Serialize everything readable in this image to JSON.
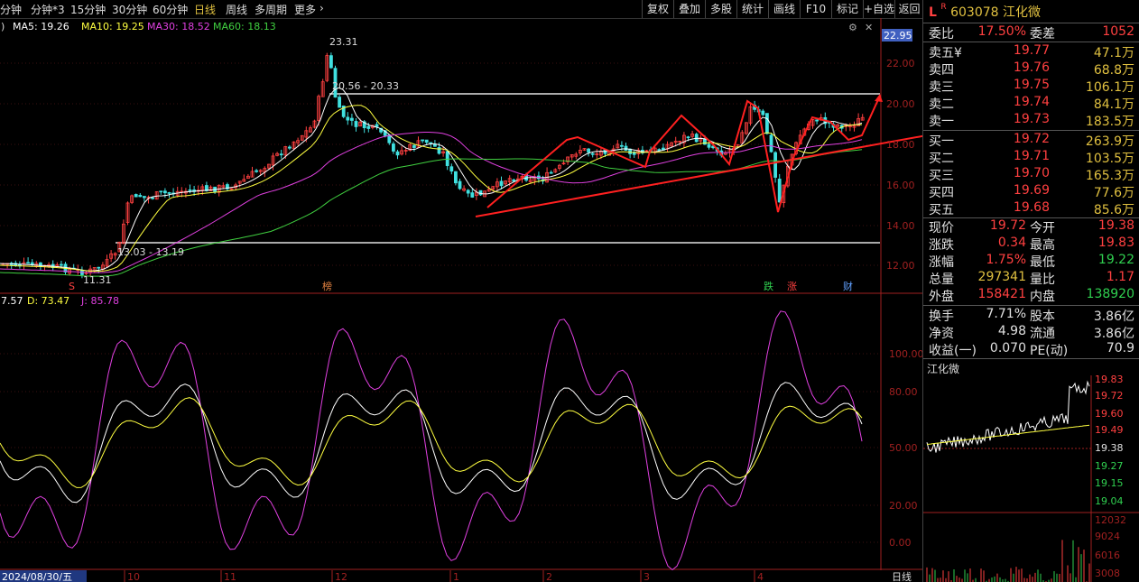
{
  "toolbar": {
    "periods": [
      "分钟",
      "分钟*3",
      "15分钟",
      "30分钟",
      "60分钟",
      "日线",
      "周线",
      "多周期",
      "更多"
    ],
    "active_period": "日线",
    "buttons": [
      "复权",
      "叠加",
      "多股",
      "统计",
      "画线",
      "F10",
      "标记",
      "+自选",
      "返回"
    ]
  },
  "stock": {
    "flag_l": "L",
    "flag_r": "R",
    "code": "603078",
    "name": "江化微"
  },
  "ma_legend": {
    "lead": ")",
    "ma5": "MA5: 19.26",
    "ma10": "MA10: 19.25",
    "ma30": "MA30: 18.52",
    "ma60": "MA60: 18.13"
  },
  "kdj_legend": {
    "k": "7.57",
    "d": "D: 73.47",
    "j": "J: 85.78"
  },
  "main_axis": {
    "labels": [
      "22.00",
      "20.00",
      "18.00",
      "16.00",
      "14.00",
      "12.00"
    ],
    "current": "22.95"
  },
  "kdj_axis": {
    "labels": [
      "100.00",
      "80.00",
      "50.00",
      "20.00",
      "0.00"
    ]
  },
  "annotations": {
    "high": "23.31",
    "resistance": "20.56 - 20.33",
    "support": "13.03 - 13.19",
    "low": "11.31",
    "marker_s": "S",
    "marker_bang": "榜",
    "marker_die": "跌",
    "marker_zhang": "涨",
    "marker_cai": "财"
  },
  "date_axis": {
    "first": "2024/08/30/五",
    "months": [
      "10",
      "11",
      "12",
      "1",
      "2",
      "3",
      "4"
    ],
    "period_label": "日线"
  },
  "orderbook": {
    "weibi_label": "委比",
    "weibi_value": "17.50%",
    "weicha_label": "委差",
    "weicha_value": "1052",
    "sells": [
      {
        "label": "卖五¥",
        "price": "19.77",
        "vol": "47.1万"
      },
      {
        "label": "卖四",
        "price": "19.76",
        "vol": "68.8万"
      },
      {
        "label": "卖三",
        "price": "19.75",
        "vol": "106.1万"
      },
      {
        "label": "卖二",
        "price": "19.74",
        "vol": "84.1万"
      },
      {
        "label": "卖一",
        "price": "19.73",
        "vol": "183.5万"
      }
    ],
    "buys": [
      {
        "label": "买一",
        "price": "19.72",
        "vol": "263.9万"
      },
      {
        "label": "买二",
        "price": "19.71",
        "vol": "103.5万"
      },
      {
        "label": "买三",
        "price": "19.70",
        "vol": "165.3万"
      },
      {
        "label": "买四",
        "price": "19.69",
        "vol": "77.6万"
      },
      {
        "label": "买五",
        "price": "19.68",
        "vol": "85.6万"
      }
    ]
  },
  "quote": [
    {
      "l1": "现价",
      "v1": "19.72",
      "c1": "red",
      "l2": "今开",
      "v2": "19.38",
      "c2": "red"
    },
    {
      "l1": "涨跌",
      "v1": "0.34",
      "c1": "red",
      "l2": "最高",
      "v2": "19.83",
      "c2": "red"
    },
    {
      "l1": "涨幅",
      "v1": "1.75%",
      "c1": "red",
      "l2": "最低",
      "v2": "19.22",
      "c2": "grn"
    },
    {
      "l1": "总量",
      "v1": "297341",
      "c1": "yel",
      "l2": "量比",
      "v2": "1.17",
      "c2": "red"
    },
    {
      "l1": "外盘",
      "v1": "158421",
      "c1": "red",
      "l2": "内盘",
      "v2": "138920",
      "c2": "grn"
    }
  ],
  "fundamentals": [
    {
      "l1": "换手",
      "v1": "7.71%",
      "l2": "股本",
      "v2": "3.86亿"
    },
    {
      "l1": "净资",
      "v1": "4.98",
      "l2": "流通",
      "v2": "3.86亿"
    },
    {
      "l1": "收益(一)",
      "v1": "0.070",
      "l2": "PE(动)",
      "v2": "70.9"
    }
  ],
  "intraday": {
    "title": "江化微",
    "price_labels": [
      "19.83",
      "19.72",
      "19.60",
      "19.49",
      "19.38",
      "19.27",
      "19.15",
      "19.04"
    ],
    "price_colors": [
      "red",
      "red",
      "red",
      "red",
      "wht",
      "grn",
      "grn",
      "grn"
    ],
    "vol_labels": [
      "12032",
      "9024",
      "6016",
      "3008"
    ]
  },
  "colors": {
    "up": "#ff4040",
    "down": "#40e0e0",
    "ma5": "#ffffff",
    "ma10": "#ffff40",
    "ma30": "#e040e0",
    "ma60": "#40d040",
    "accent": "#e0c040"
  }
}
